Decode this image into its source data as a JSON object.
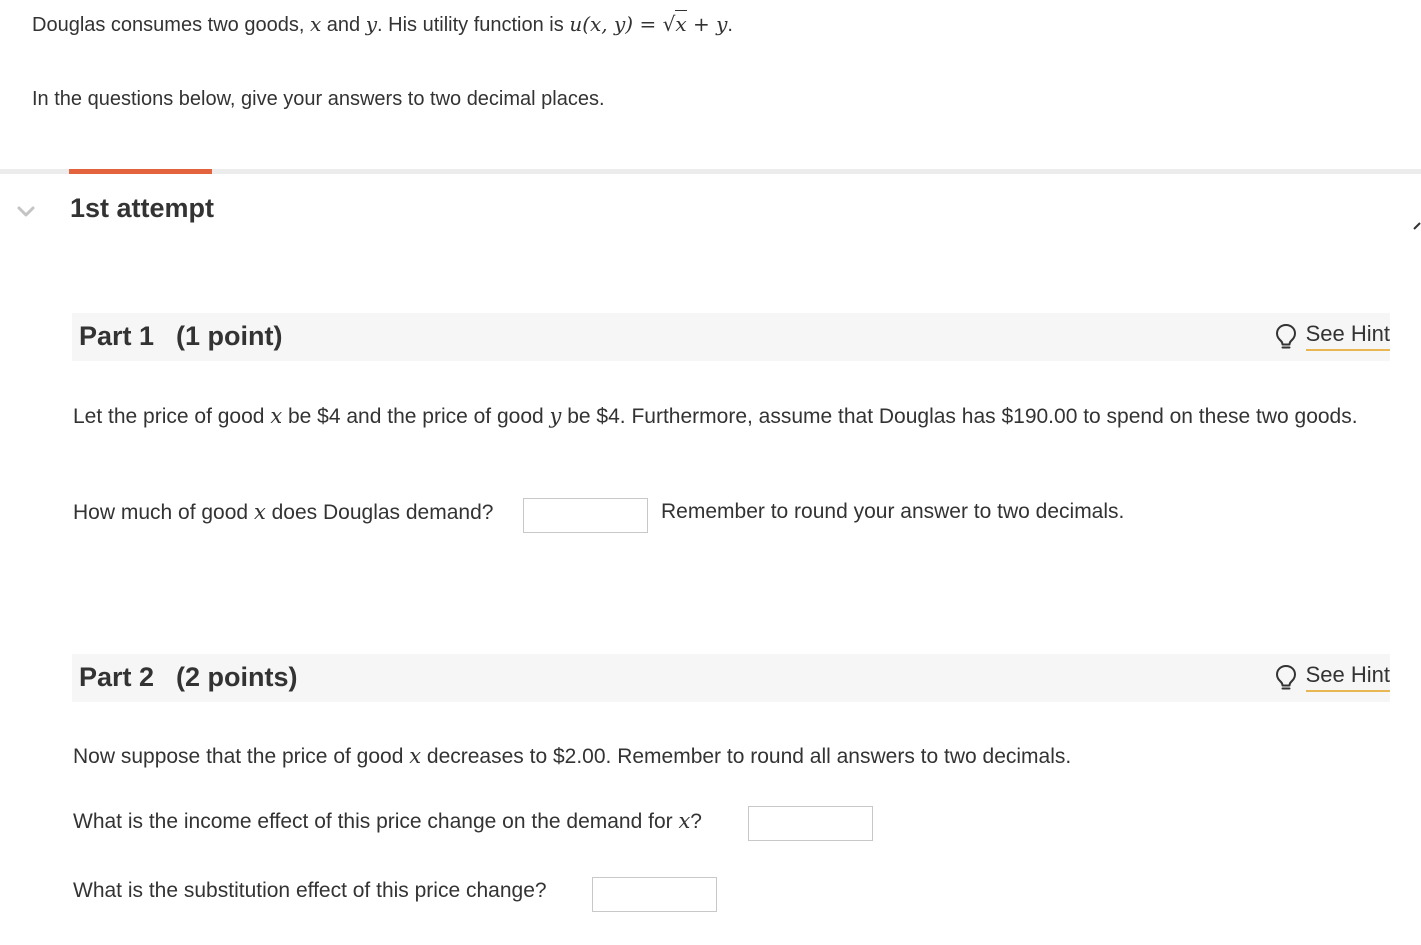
{
  "intro": {
    "line1": {
      "before": "Douglas consumes two goods, ",
      "var_x": "x",
      "and": " and ",
      "var_y": "y",
      "after": ". His utility function is ",
      "formula_lhs": "u(x, y)",
      "equals": " = ",
      "sqrt_symbol": "√",
      "sqrt_arg": "x",
      "plus_y": " + y",
      "end": "."
    },
    "line2": "In the questions below, give your answers to two decimal places."
  },
  "attempt": {
    "title": "1st attempt",
    "accent_color": "#e4633f"
  },
  "part1": {
    "title": "Part 1",
    "points": "(1 point)",
    "hint_label": "See Hint",
    "prompt": {
      "a": "Let the price of good ",
      "x": "x",
      "b": " be $4 and the price of good ",
      "y": "y",
      "c": " be $4. Furthermore, assume that Douglas has $190.00 to spend on these two goods."
    },
    "question": {
      "a": "How much of good ",
      "x": "x",
      "b": " does Douglas demand?"
    },
    "answer_value": "",
    "reminder": "Remember to round your answer to two decimals."
  },
  "part2": {
    "title": "Part 2",
    "points": "(2 points)",
    "hint_label": "See Hint",
    "prompt": {
      "a": "Now suppose that the price of good ",
      "x": "x",
      "b": " decreases to $2.00. Remember to round all answers to two decimals."
    },
    "q1": {
      "a": "What is the income effect of this price change on the demand for ",
      "x": "x",
      "b": "?"
    },
    "q1_value": "",
    "q2": "What is the substitution effect of this price change?",
    "q2_value": ""
  },
  "icons": {
    "chevron": "chevron-down-icon",
    "hint": "lightbulb-icon"
  }
}
